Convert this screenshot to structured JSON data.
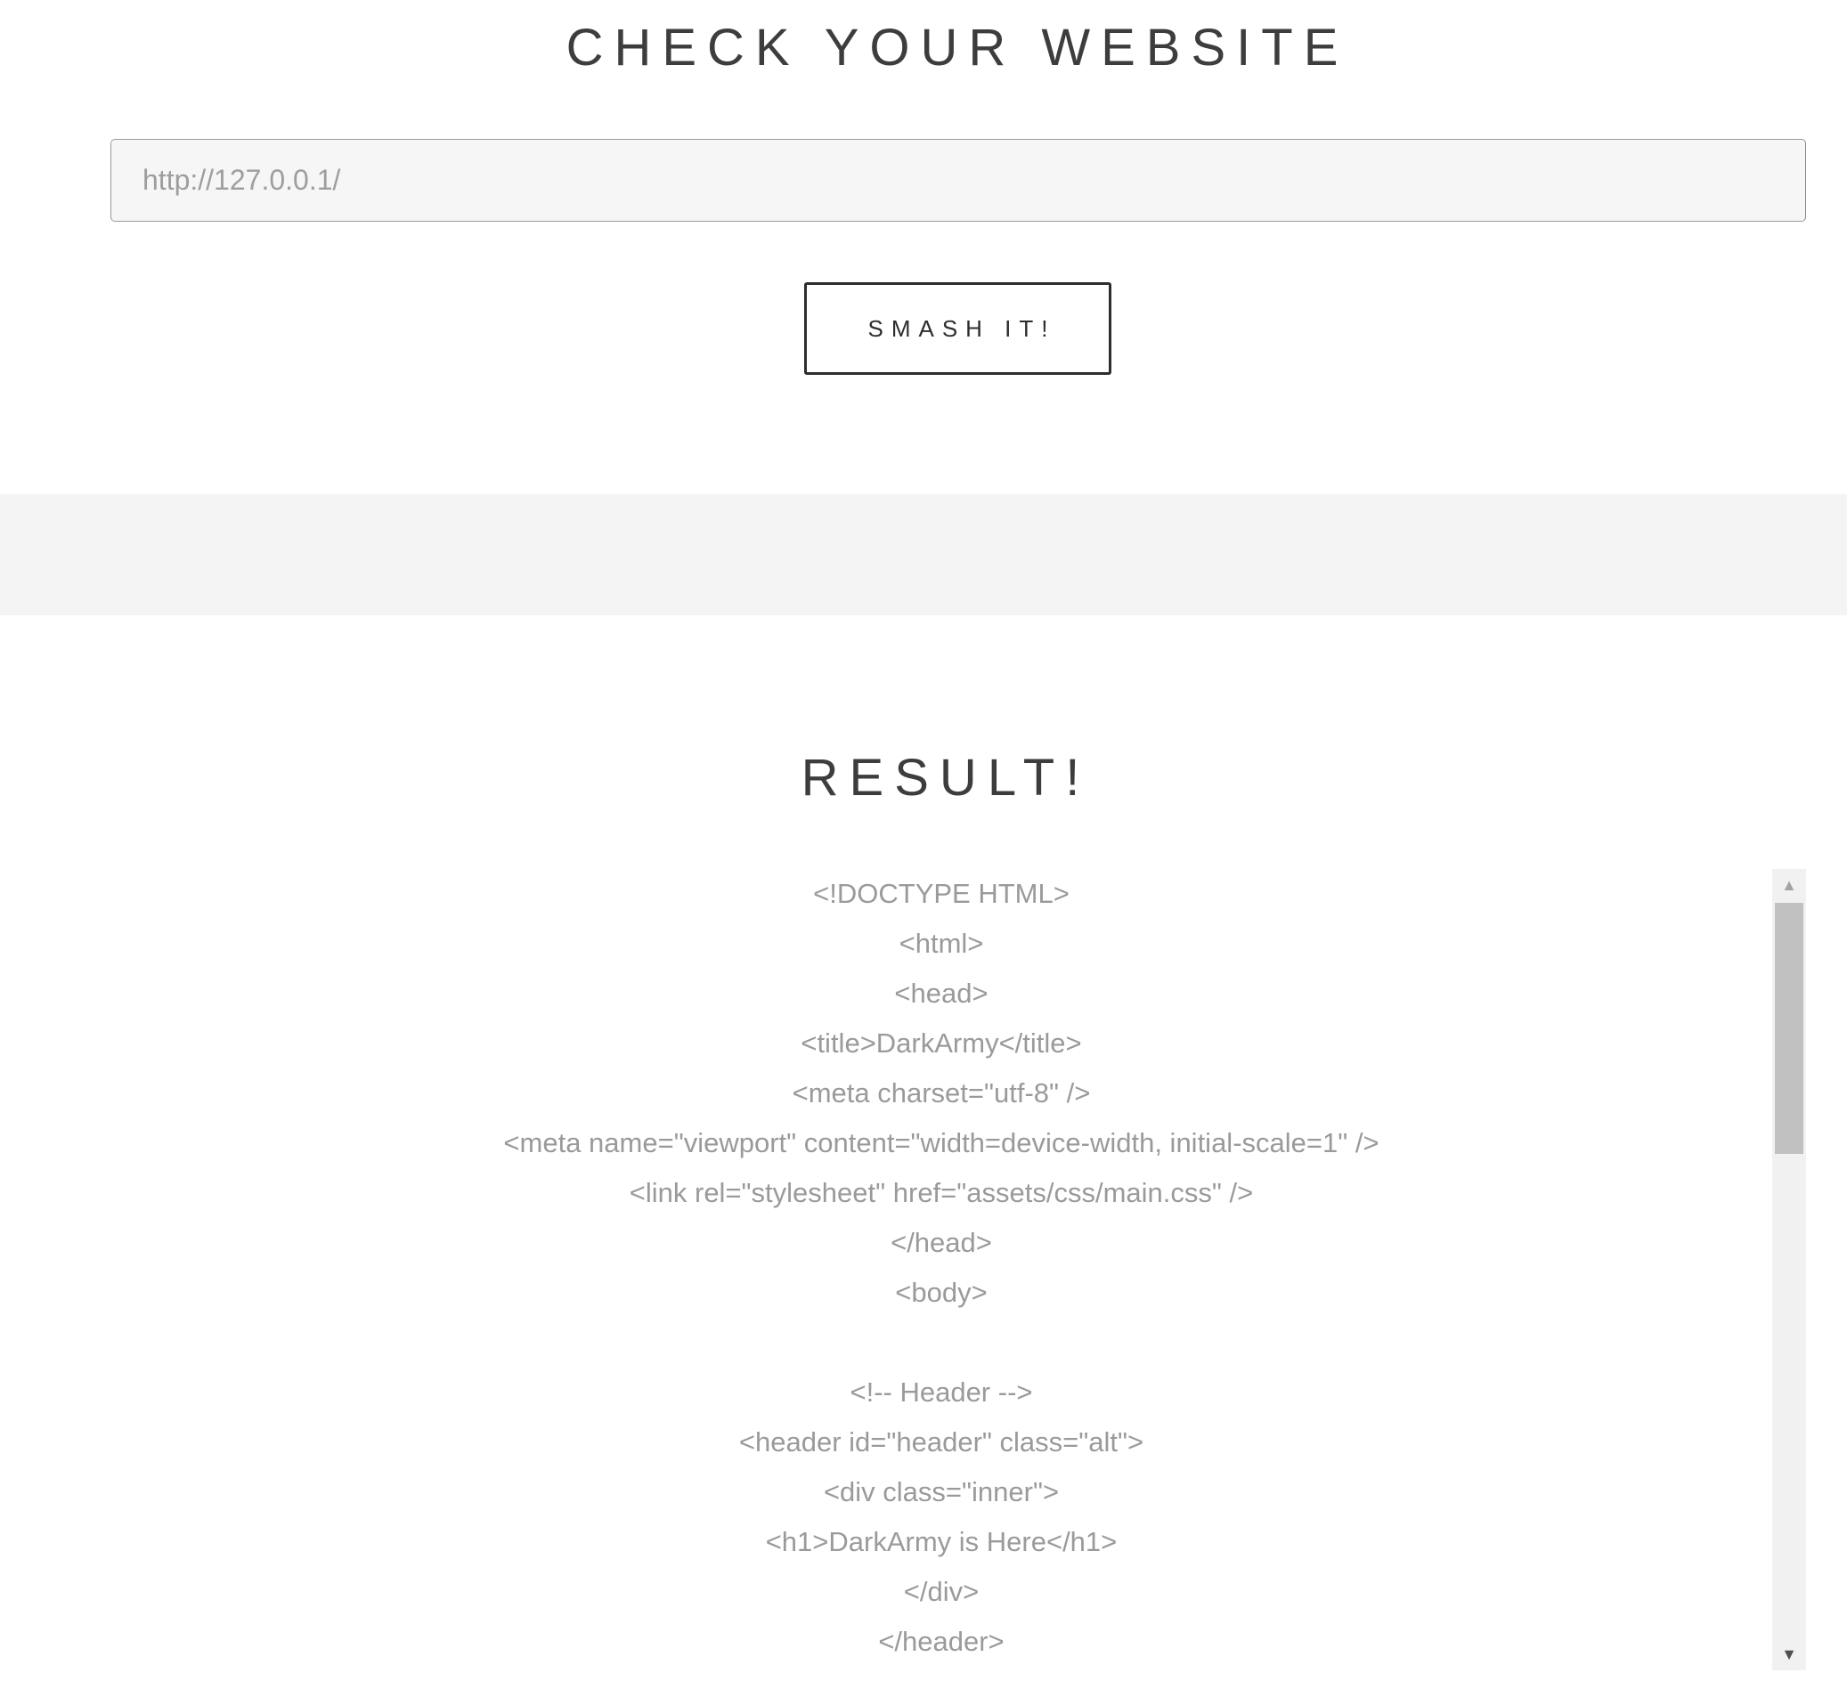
{
  "header": {
    "title": "CHECK YOUR WEBSITE"
  },
  "url_form": {
    "input_value": "http://127.0.0.1/",
    "submit_label": "SMASH IT!"
  },
  "result": {
    "title": "RESULT!",
    "lines": [
      "<!DOCTYPE HTML>",
      "<html>",
      "<head>",
      "<title>DarkArmy</title>",
      "<meta charset=\"utf-8\" />",
      "<meta name=\"viewport\" content=\"width=device-width, initial-scale=1\" />",
      "<link rel=\"stylesheet\" href=\"assets/css/main.css\" />",
      "</head>",
      "<body>",
      "",
      "<!-- Header -->",
      "<header id=\"header\" class=\"alt\">",
      "<div class=\"inner\">",
      "<h1>DarkArmy is Here</h1>",
      "</div>",
      "</header>"
    ]
  },
  "colors": {
    "title_text": "#3d3d3d",
    "code_text": "#9a9a9a",
    "band_background": "#f4f4f4",
    "input_background": "#f6f6f6"
  },
  "icons": {
    "scroll_up": "triangle-up-icon",
    "scroll_down": "triangle-down-icon"
  }
}
